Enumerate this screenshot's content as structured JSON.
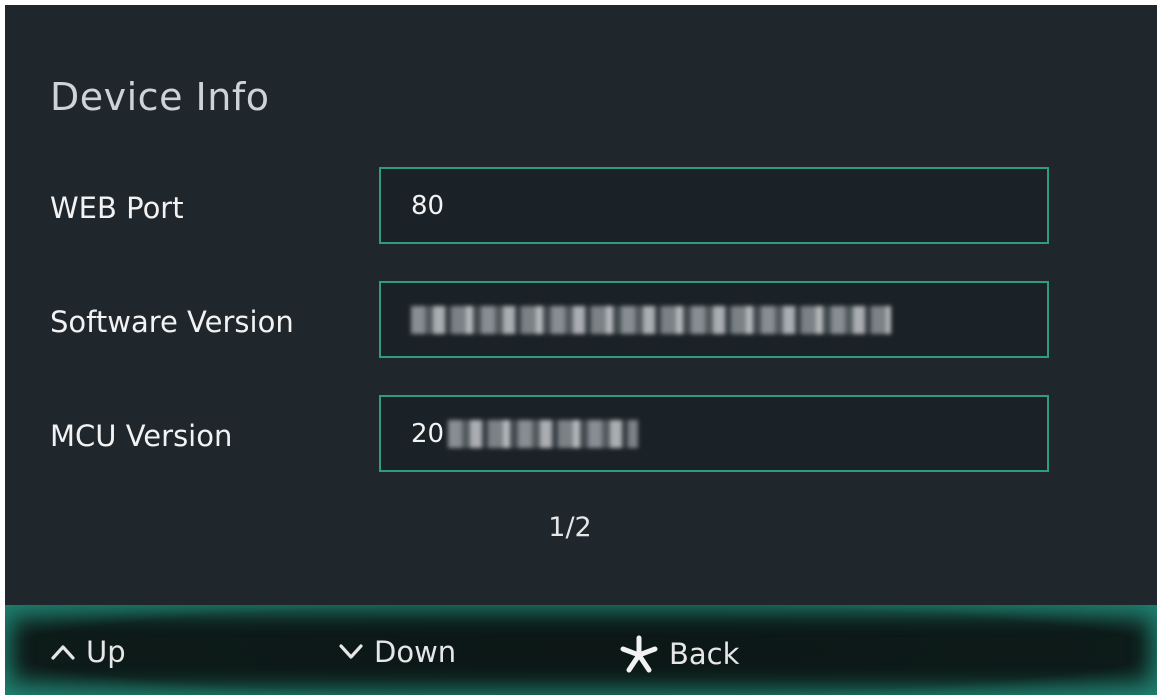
{
  "title": "Device Info",
  "rows": [
    {
      "label": "WEB Port",
      "value": "80",
      "redacted": false
    },
    {
      "label": "Software Version",
      "value": "",
      "redacted": true
    },
    {
      "label": "MCU Version",
      "value": "20",
      "redacted": true
    }
  ],
  "page_indicator": "1/2",
  "footer": {
    "up_label": "Up",
    "down_label": "Down",
    "back_label": "Back",
    "up_icon": "chevron-up-icon",
    "down_icon": "chevron-down-icon",
    "back_icon": "asterisk-icon"
  },
  "colors": {
    "background": "#1f262c",
    "accent": "#2f9b85",
    "text": "#f2f2f2"
  }
}
